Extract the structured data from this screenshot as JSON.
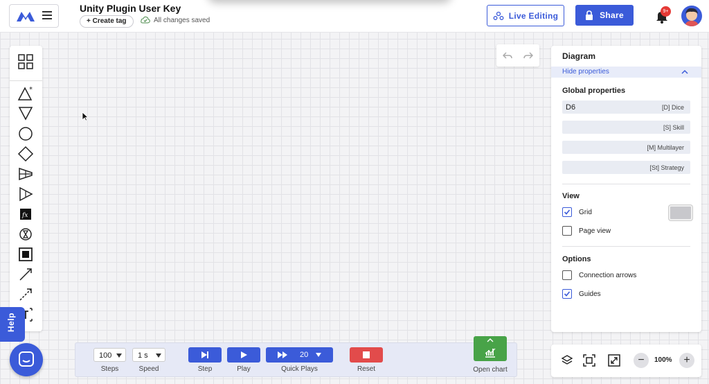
{
  "header": {
    "title": "Unity Plugin User Key",
    "create_tag_label": "Create tag",
    "saved_status": "All changes saved",
    "live_editing_label": "Live Editing",
    "share_label": "Share",
    "notification_badge": "9+"
  },
  "colors": {
    "accent": "#3b5bd9",
    "reset": "#e24b4b",
    "chart": "#48a348"
  },
  "toolbar_icons": [
    "grid-icon",
    "triangle-star-icon",
    "triangle-down-icon",
    "circle-icon",
    "diamond-icon",
    "converter-icon",
    "play-triangle-icon",
    "function-icon",
    "hourglass-icon",
    "square-icon",
    "arrow-icon",
    "dashed-arrow-icon",
    "text-icon"
  ],
  "panel": {
    "title": "Diagram",
    "hide_label": "Hide properties",
    "global_title": "Global properties",
    "props": [
      {
        "value": "D6",
        "tag": "[D] Dice"
      },
      {
        "value": "",
        "tag": "[S] Skill"
      },
      {
        "value": "",
        "tag": "[M] Multilayer"
      },
      {
        "value": "",
        "tag": "[St] Strategy"
      }
    ],
    "view_title": "View",
    "grid_label": "Grid",
    "grid_checked": true,
    "pageview_label": "Page view",
    "pageview_checked": false,
    "options_title": "Options",
    "arrows_label": "Connection arrows",
    "arrows_checked": false,
    "guides_label": "Guides",
    "guides_checked": true
  },
  "zoom": {
    "level": "100%"
  },
  "simulation": {
    "steps_value": "100",
    "steps_label": "Steps",
    "speed_value": "1 s",
    "speed_label": "Speed",
    "step_label": "Step",
    "play_label": "Play",
    "quick_value": "20",
    "quick_label": "Quick Plays",
    "reset_label": "Reset",
    "chart_label": "Open chart"
  },
  "help_label": "Help"
}
